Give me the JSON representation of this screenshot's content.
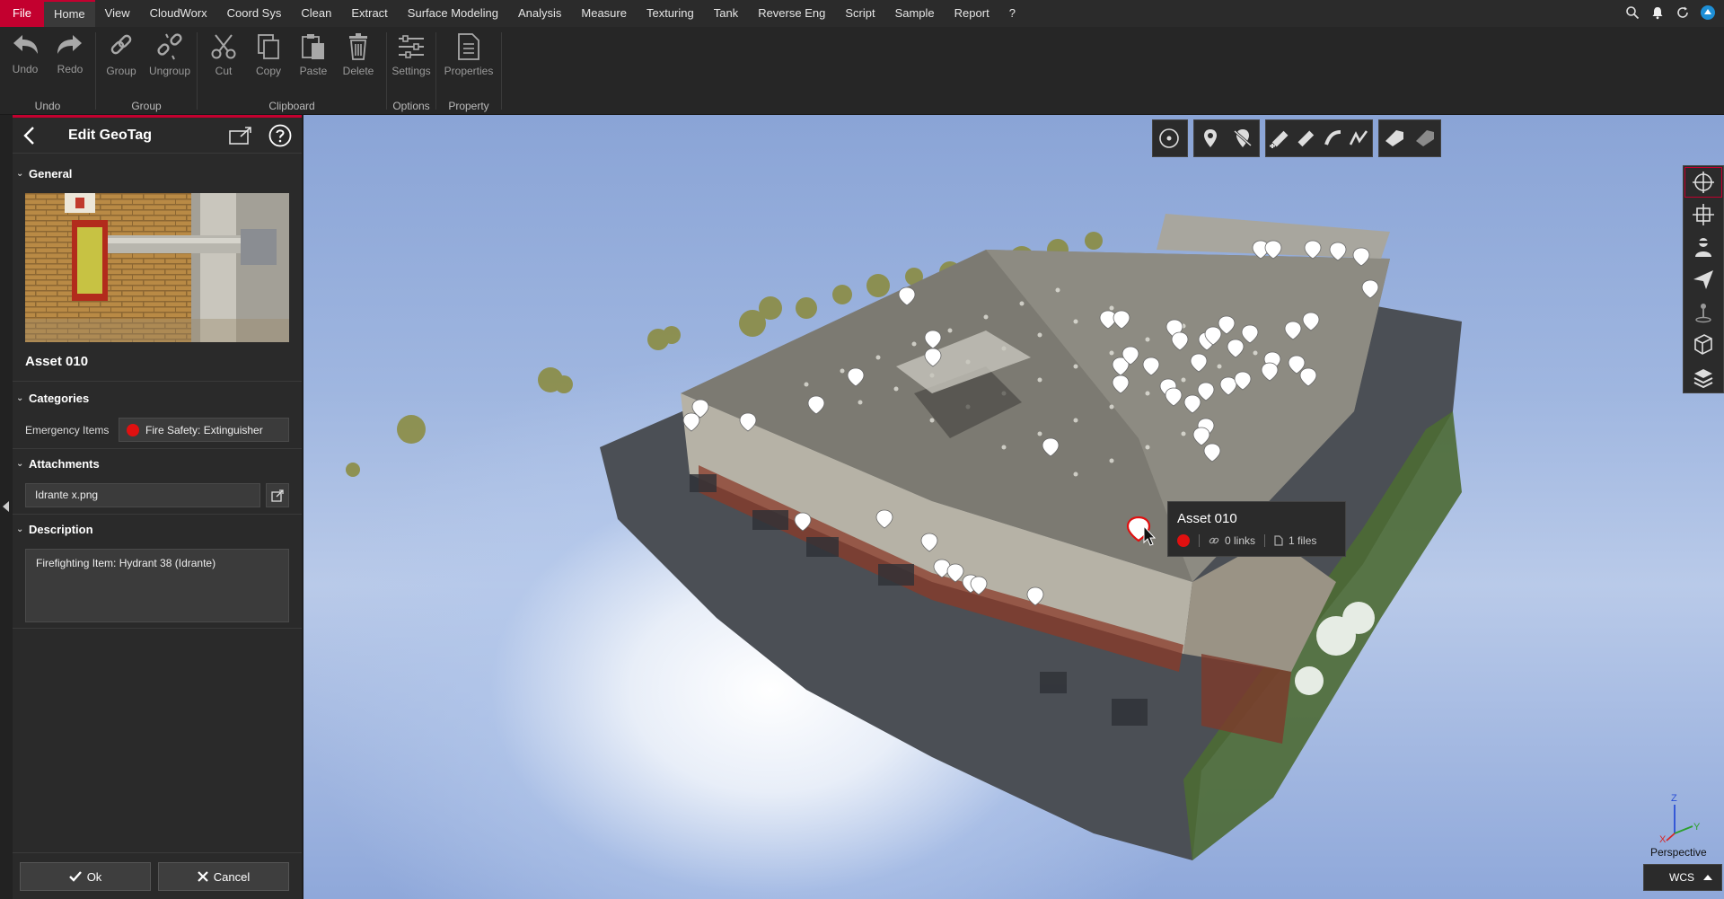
{
  "menu": {
    "items": [
      "File",
      "Home",
      "View",
      "CloudWorx",
      "Coord Sys",
      "Clean",
      "Extract",
      "Surface Modeling",
      "Analysis",
      "Measure",
      "Texturing",
      "Tank",
      "Reverse Eng",
      "Script",
      "Sample",
      "Report",
      "?"
    ],
    "active": "Home"
  },
  "ribbon": {
    "undo": "Undo",
    "redo": "Redo",
    "group": "Group",
    "ungroup": "Ungroup",
    "cut": "Cut",
    "copy": "Copy",
    "paste": "Paste",
    "delete": "Delete",
    "settings": "Settings",
    "properties": "Properties",
    "groups": {
      "undo": "Undo",
      "group": "Group",
      "clipboard": "Clipboard",
      "options": "Options",
      "property": "Property"
    }
  },
  "panel": {
    "title": "Edit GeoTag",
    "general": "General",
    "asset_name": "Asset 010",
    "categories": "Categories",
    "category_label": "Emergency Items",
    "category_value": "Fire Safety: Extinguisher",
    "attachments": "Attachments",
    "attachment_file": "Idrante x.png",
    "description": "Description",
    "description_text": "Firefighting Item: Hydrant 38 (Idrante)",
    "ok": "Ok",
    "cancel": "Cancel"
  },
  "tooltip": {
    "title": "Asset 010",
    "links": "0 links",
    "files": "1 files"
  },
  "viewport": {
    "projection": "Perspective",
    "coord_system": "WCS"
  },
  "colors": {
    "accent": "#c3002f",
    "tag_red": "#e01010"
  }
}
